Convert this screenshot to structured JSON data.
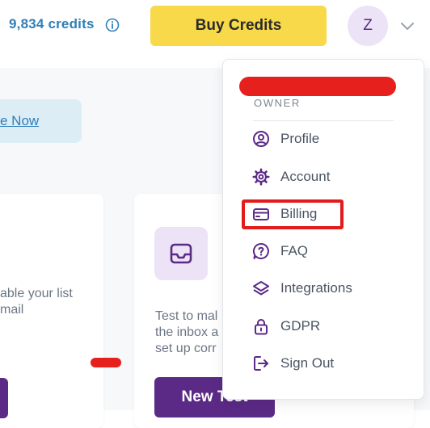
{
  "header": {
    "credits_label": "9,834 credits",
    "buy_button_label": "Buy Credits",
    "avatar_initial": "Z",
    "icons": {
      "info": "info-icon",
      "chevron": "chevron-down-icon"
    }
  },
  "banner": {
    "link_text": "e Now"
  },
  "cards": {
    "left_text": "able your list\nmail",
    "right_text": "Test to mal\nthe inbox a\nset up corr",
    "new_test_label": "New Test",
    "inbox_icon": "inbox-icon"
  },
  "account_menu": {
    "role_label": "OWNER",
    "items": [
      {
        "label": "Profile",
        "icon": "user-circle-icon"
      },
      {
        "label": "Account",
        "icon": "gear-icon"
      },
      {
        "label": "Billing",
        "icon": "credit-card-icon"
      },
      {
        "label": "FAQ",
        "icon": "question-bubble-icon"
      },
      {
        "label": "Integrations",
        "icon": "layers-icon"
      },
      {
        "label": "GDPR",
        "icon": "lock-icon"
      },
      {
        "label": "Sign Out",
        "icon": "sign-out-icon"
      }
    ]
  },
  "colors": {
    "brand_purple": "#5b2a86",
    "accent_yellow": "#f7d94a",
    "link_blue": "#2f7fb8",
    "highlight_red": "#e21b1b"
  }
}
